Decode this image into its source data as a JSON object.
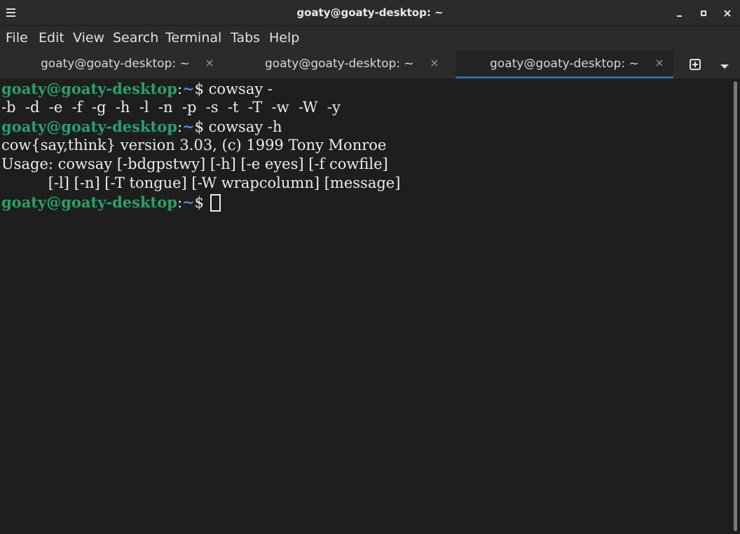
{
  "window": {
    "title": "goaty@goaty-desktop: ~"
  },
  "menu": {
    "items": [
      "File",
      "Edit",
      "View",
      "Search",
      "Terminal",
      "Tabs",
      "Help"
    ]
  },
  "tabs": [
    {
      "label": "goaty@goaty-desktop: ~",
      "close": "×",
      "active": false
    },
    {
      "label": "goaty@goaty-desktop: ~",
      "close": "×",
      "active": false
    },
    {
      "label": "goaty@goaty-desktop: ~",
      "close": "×",
      "active": true
    }
  ],
  "terminal": {
    "lines": [
      {
        "type": "prompt",
        "user": "goaty@goaty-desktop",
        "path": "~",
        "symbol": "$",
        "command": " cowsay -"
      },
      {
        "type": "output",
        "text": "-b  -d  -e  -f  -g  -h  -l  -n  -p  -s  -t  -T  -w  -W  -y"
      },
      {
        "type": "prompt",
        "user": "goaty@goaty-desktop",
        "path": "~",
        "symbol": "$",
        "command": " cowsay -h"
      },
      {
        "type": "output",
        "text": "cow{say,think} version 3.03, (c) 1999 Tony Monroe"
      },
      {
        "type": "output",
        "text": "Usage: cowsay [-bdgpstwy] [-h] [-e eyes] [-f cowfile]"
      },
      {
        "type": "output",
        "text": "          [-l] [-n] [-T tongue] [-W wrapcolumn] [message]"
      },
      {
        "type": "prompt",
        "user": "goaty@goaty-desktop",
        "path": "~",
        "symbol": "$",
        "command": " ",
        "cursor": true
      }
    ]
  },
  "colors": {
    "user": "#26a269",
    "path": "#4a90d9",
    "accent": "#2f6db4",
    "background": "#1e1e1e"
  },
  "icons": {
    "menu": "hamburger-icon",
    "minimize": "minimize-icon",
    "maximize": "maximize-icon",
    "close": "close-icon",
    "new_tab": "new-tab-icon",
    "tab_menu": "chevron-down-icon"
  }
}
